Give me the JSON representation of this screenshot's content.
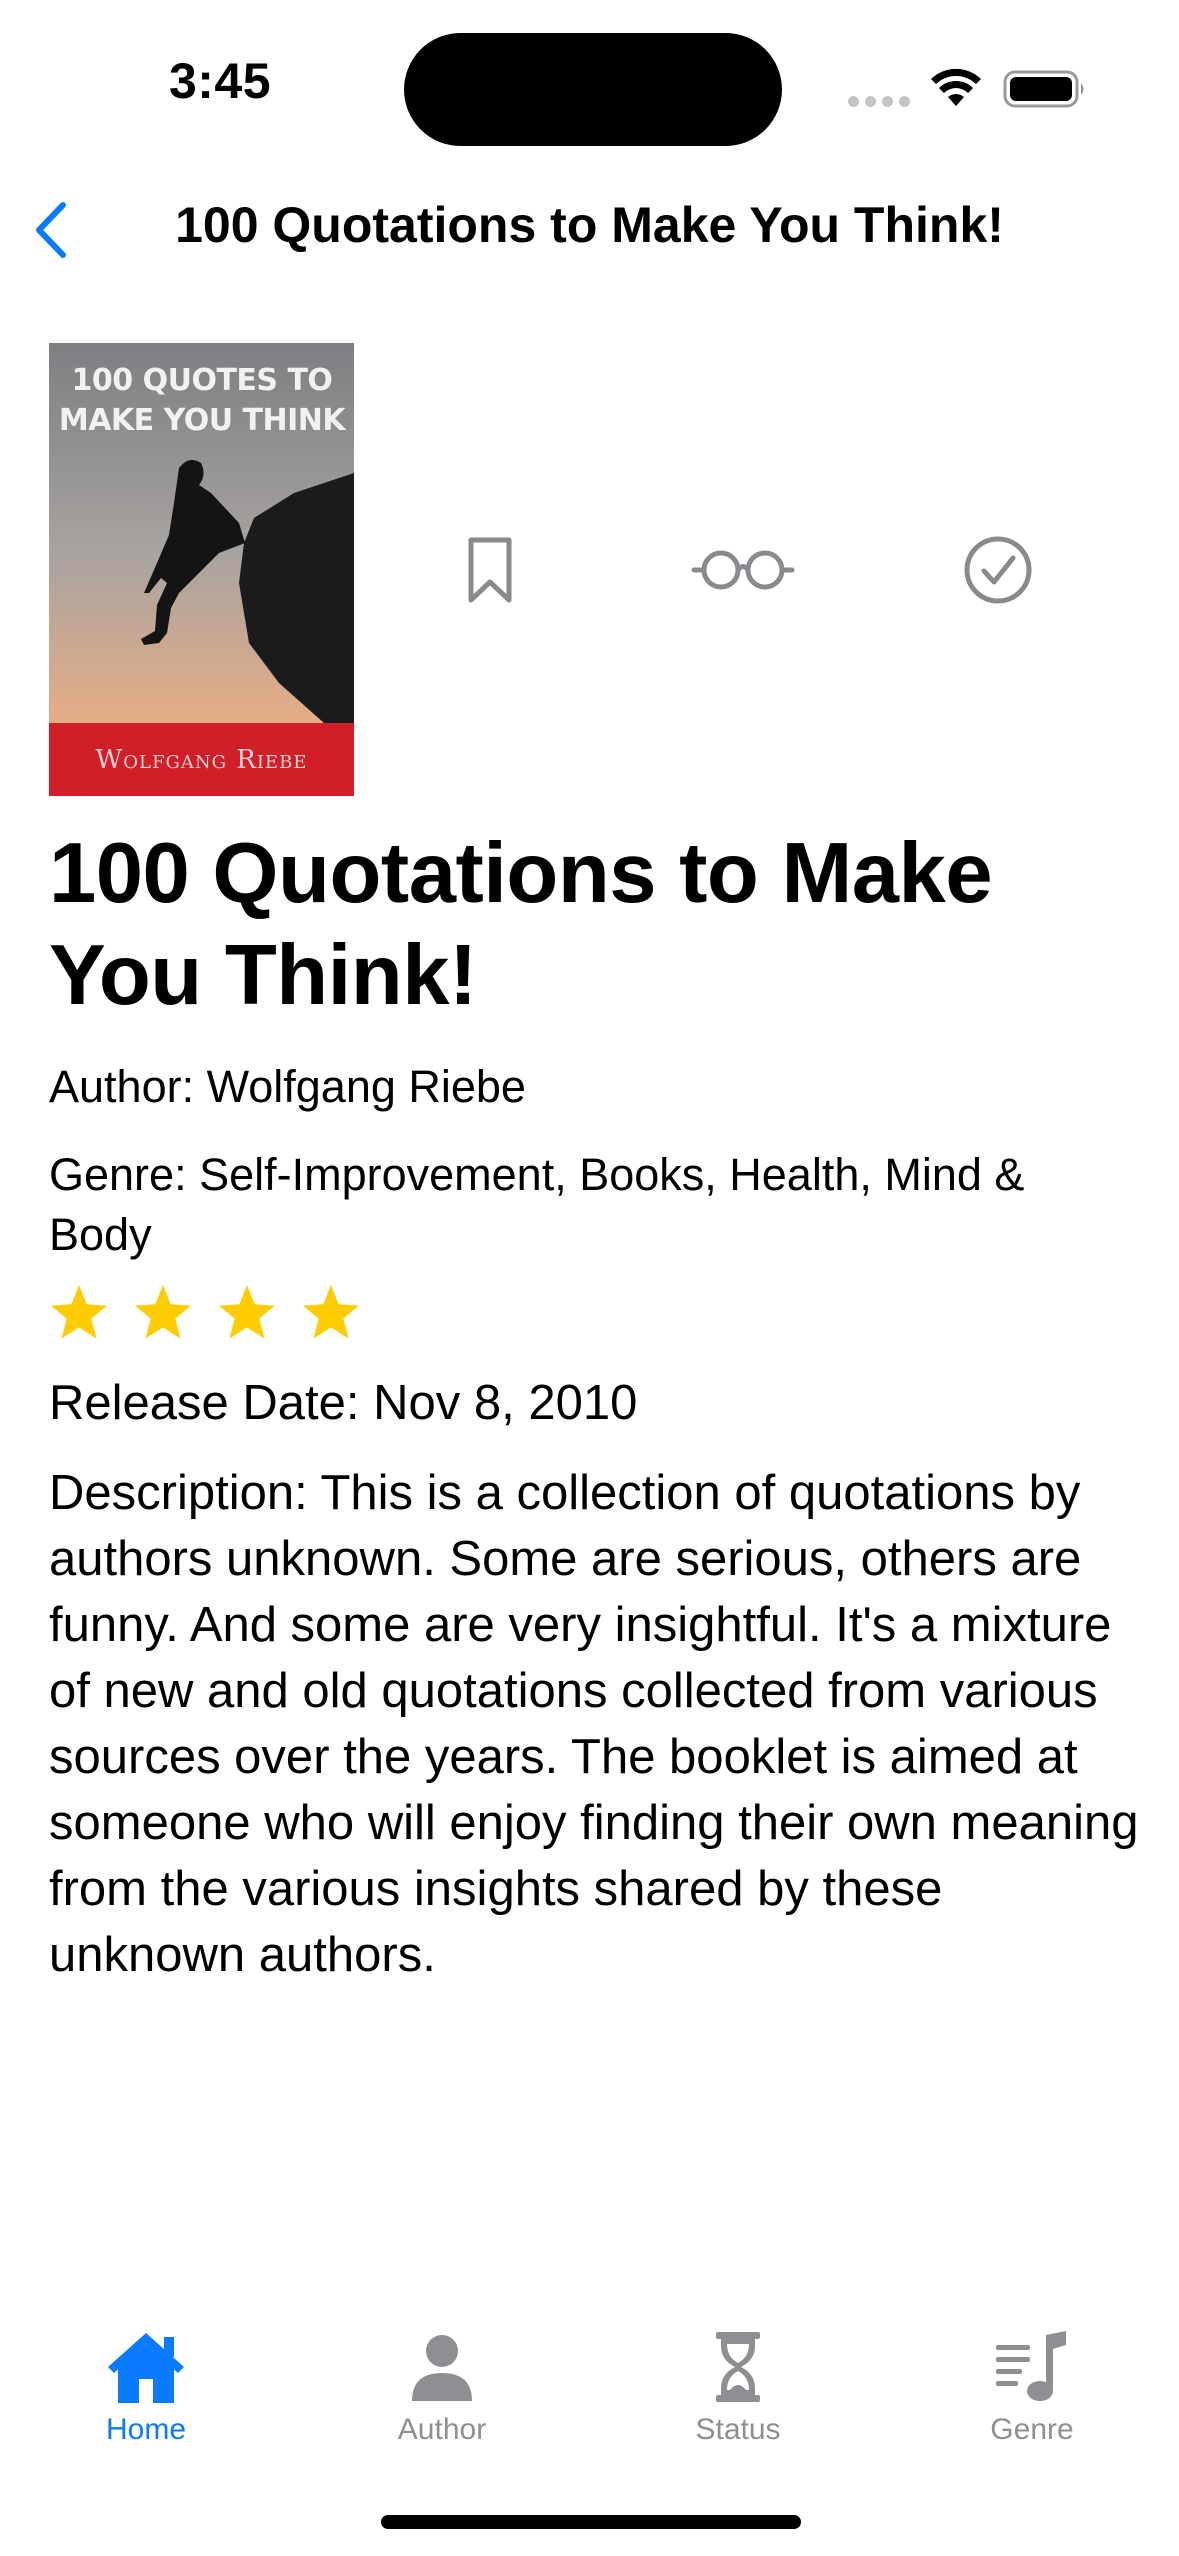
{
  "status_bar": {
    "time": "3:45"
  },
  "nav": {
    "back_icon": "chevron-left-icon",
    "title": "100 Quotations to Make You Think!"
  },
  "cover": {
    "title": "100 QUOTES TO MAKE YOU THINK",
    "author": "Wolfgang Riebe"
  },
  "actions": {
    "bookmark_icon": "bookmark-icon",
    "reading_icon": "eyeglasses-icon",
    "finished_icon": "checkmark-circle-icon"
  },
  "book": {
    "title": "100 Quotations to Make You Think!",
    "author": "Author: Wolfgang Riebe",
    "genre": "Genre: Self-Improvement, Books, Health, Mind & Body",
    "rating": 4,
    "release_date": "Release Date: Nov 8, 2010",
    "description": "Description: This is a collection of quotations by authors unknown. Some are serious, others are funny. And some are very insightful. It's a mixture of new and old quotations collected from various sources over the years. The booklet is aimed at someone who will enjoy finding their own meaning from the various insights shared by these unknown authors."
  },
  "tabs": [
    {
      "label": "Home",
      "icon": "house-fill-icon",
      "active": true
    },
    {
      "label": "Author",
      "icon": "person-fill-icon",
      "active": false
    },
    {
      "label": "Status",
      "icon": "hourglass-icon",
      "active": false
    },
    {
      "label": "Genre",
      "icon": "music-note-list-icon",
      "active": false
    }
  ],
  "colors": {
    "accent": "#0a7aff",
    "star": "#ffcc00",
    "inactive_tab": "#8e8e93",
    "action_icon": "#8a8a8e",
    "cover_band": "#d01f28"
  }
}
